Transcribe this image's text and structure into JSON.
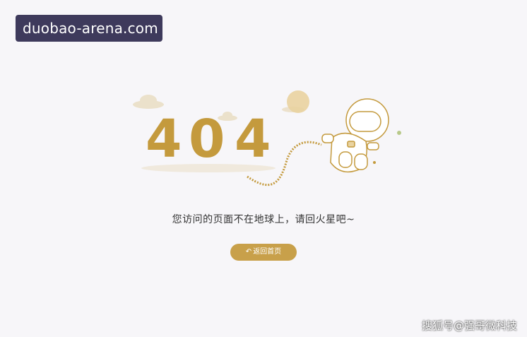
{
  "watermarks": {
    "top": "duobao-arena.com",
    "bottom": "搜狐号@强哥微科技"
  },
  "error": {
    "digits": [
      "4",
      "0",
      "4"
    ],
    "message": "您访问的页面不在地球上，请回火星吧~"
  },
  "button": {
    "label": "返回首页",
    "icon": "return-arrow-icon"
  },
  "colors": {
    "accent": "#c8a04a",
    "digits": "#c49a3d",
    "background": "#f7f6f9"
  }
}
